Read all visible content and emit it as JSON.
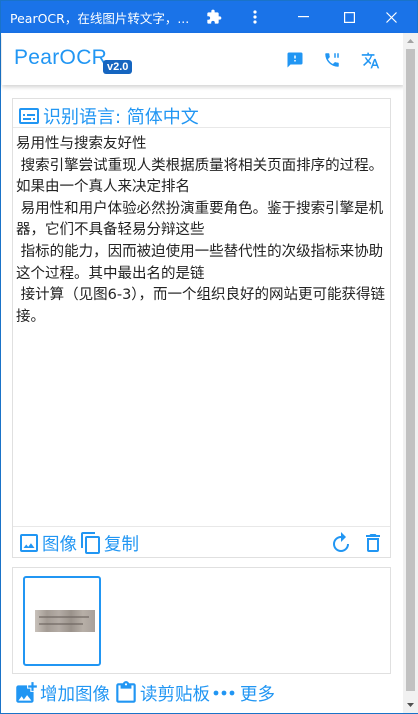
{
  "window": {
    "title": "PearOCR，在线图片转文字，..."
  },
  "header": {
    "brand": "PearOCR",
    "version": "v2.0",
    "icons": [
      "feedback-icon",
      "contact-icon",
      "translate-icon"
    ]
  },
  "panel": {
    "language_label": "识别语言: 简体中文",
    "result_text": "易用性与搜索友好性\n 搜索引擎尝试重现人类根据质量将相关页面排序的过程。如果由一个真人来决定排名\n 易用性和用户体验必然扮演重要角色。鉴于搜索引擎是机器，它们不具备轻易分辩这些\n 指标的能力，因而被迫使用一些替代性的次级指标来协助这个过程。其中最出名的是链\n 接计算（见图6-3），而一个组织良好的网站更可能获得链接。",
    "image_label": "图像",
    "copy_label": "复制"
  },
  "bottom": {
    "add_image_label": "增加图像",
    "read_clipboard_label": "读剪贴板",
    "more_label": "更多"
  },
  "colors": {
    "accent": "#2196f3",
    "titlebar": "#1a73e8",
    "version_badge": "#1565c0"
  }
}
